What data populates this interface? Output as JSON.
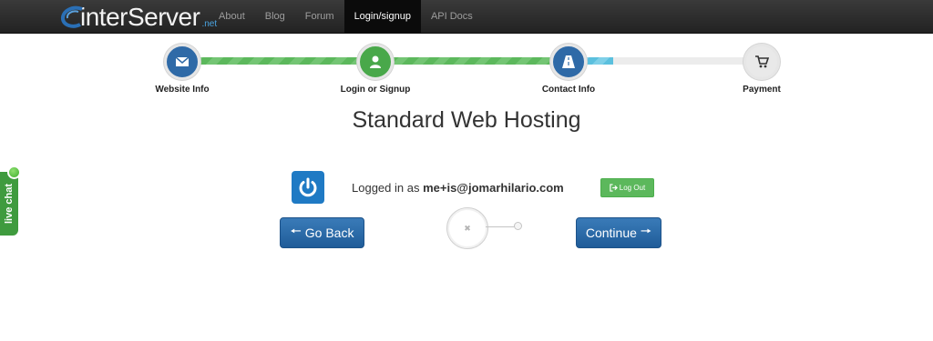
{
  "brand": {
    "name": "interServer",
    "tld": ".net"
  },
  "nav": {
    "items": [
      {
        "label": "About",
        "active": false
      },
      {
        "label": "Blog",
        "active": false
      },
      {
        "label": "Forum",
        "active": false
      },
      {
        "label": "Login/signup",
        "active": true
      },
      {
        "label": "API Docs",
        "active": false
      }
    ]
  },
  "progress": {
    "steps": [
      {
        "label": "Website Info",
        "icon": "envelope-icon",
        "state": "complete"
      },
      {
        "label": "Login or Signup",
        "icon": "user-icon",
        "state": "complete"
      },
      {
        "label": "Contact Info",
        "icon": "road-icon",
        "state": "current"
      },
      {
        "label": "Payment",
        "icon": "cart-icon",
        "state": "pending"
      }
    ],
    "completed_fraction": 0.6667,
    "current_fraction": 0.7
  },
  "page": {
    "title": "Standard Web Hosting"
  },
  "account": {
    "logged_in_prefix": "Logged in as",
    "email": "me+is@jomarhilario.com",
    "logout_label": "Log Out"
  },
  "actions": {
    "back_label": "Go Back",
    "continue_label": "Continue"
  },
  "live_chat": {
    "label": "live chat"
  },
  "colors": {
    "navbar": "#222222",
    "step_blue": "#2f6aa7",
    "step_green": "#49a84a",
    "progress_green": "#5cb85c",
    "progress_blue": "#5bc0de",
    "button_blue": "#2a6aaa",
    "logout_green": "#5cb85c",
    "live_chat_green": "#3f9b3e"
  }
}
